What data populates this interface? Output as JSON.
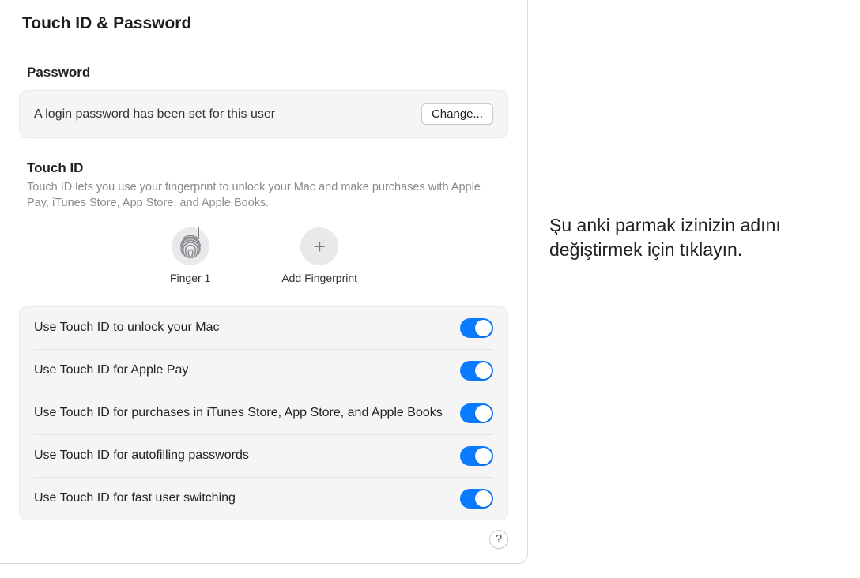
{
  "page_title": "Touch ID & Password",
  "password_section": {
    "heading": "Password",
    "status_text": "A login password has been set for this user",
    "change_button": "Change..."
  },
  "touchid_section": {
    "heading": "Touch ID",
    "description": "Touch ID lets you use your fingerprint to unlock your Mac and make purchases with Apple Pay, iTunes Store, App Store, and Apple Books.",
    "fingerprints": [
      {
        "label": "Finger 1"
      }
    ],
    "add_label": "Add Fingerprint"
  },
  "options": [
    {
      "label": "Use Touch ID to unlock your Mac",
      "on": true
    },
    {
      "label": "Use Touch ID for Apple Pay",
      "on": true
    },
    {
      "label": "Use Touch ID for purchases in iTunes Store, App Store, and Apple Books",
      "on": true
    },
    {
      "label": "Use Touch ID for autofilling passwords",
      "on": true
    },
    {
      "label": "Use Touch ID for fast user switching",
      "on": true
    }
  ],
  "help_label": "?",
  "callout_text": "Şu anki parmak izinizin adını değiştirmek için tıklayın."
}
